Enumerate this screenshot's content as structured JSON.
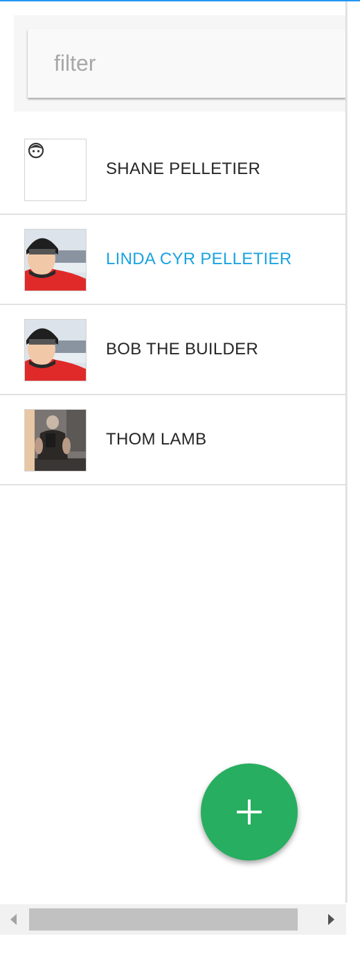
{
  "filter": {
    "placeholder": "filter",
    "value": ""
  },
  "contacts": [
    {
      "name": "SHANE PELLETIER",
      "avatar": "default-face-icon",
      "active": false
    },
    {
      "name": "LINDA CYR PELLETIER",
      "avatar": "photo-helmet-red-jacket",
      "active": true
    },
    {
      "name": "BOB THE BUILDER",
      "avatar": "photo-helmet-red-jacket",
      "active": false
    },
    {
      "name": "THOM LAMB",
      "avatar": "photo-gym-selfie",
      "active": false
    }
  ],
  "fab": {
    "icon": "plus-icon"
  },
  "colors": {
    "accent": "#2196f3",
    "active_name": "#1aa3e0",
    "fab": "#27ae60",
    "text": "#262626"
  }
}
